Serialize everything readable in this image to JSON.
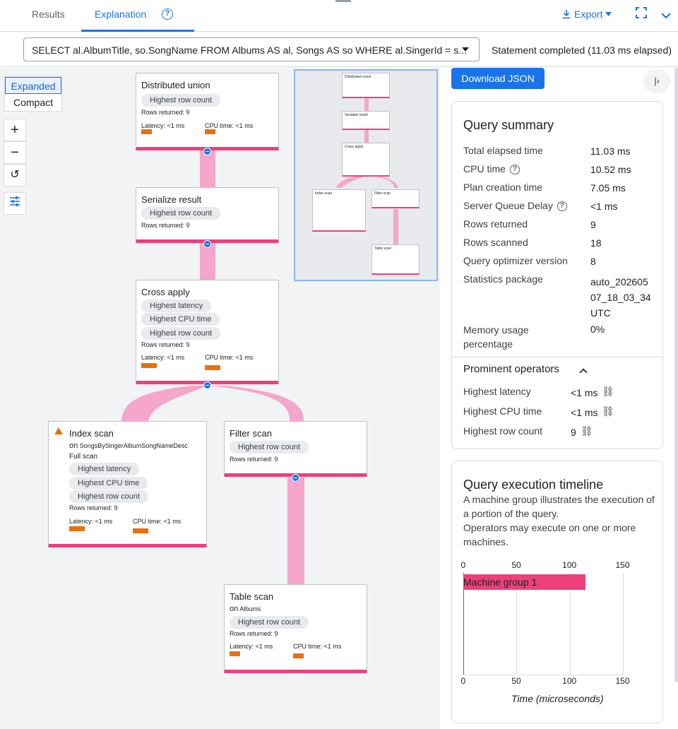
{
  "tabs": {
    "results": "Results",
    "explanation": "Explanation"
  },
  "toolbar": {
    "export_label": "Export"
  },
  "query": {
    "text": "SELECT al.AlbumTitle, so.SongName FROM Albums AS al, Songs AS so WHERE al.SingerId = s...",
    "status": "Statement completed (11.03 ms elapsed)"
  },
  "view": {
    "expanded": "Expanded",
    "compact": "Compact"
  },
  "nodes": {
    "distributed_union": {
      "title": "Distributed union",
      "chips": [
        "Highest row count"
      ],
      "rows": "Rows returned: 9",
      "latency": "Latency: <1 ms",
      "cpu": "CPU time: <1 ms"
    },
    "serialize_result": {
      "title": "Serialize result",
      "chips": [
        "Highest row count"
      ],
      "rows": "Rows returned: 9"
    },
    "cross_apply": {
      "title": "Cross apply",
      "chips": [
        "Highest latency",
        "Highest CPU time",
        "Highest row count"
      ],
      "rows": "Rows returned: 9",
      "latency": "Latency: <1 ms",
      "cpu": "CPU time: <1 ms"
    },
    "index_scan": {
      "title": "Index scan",
      "on_prefix": "on",
      "on_target": "SongsBySingerAlbumSongNameDesc",
      "scan_type": "Full scan",
      "chips": [
        "Highest latency",
        "Highest CPU time",
        "Highest row count"
      ],
      "rows": "Rows returned: 9",
      "latency": "Latency: <1 ms",
      "cpu": "CPU time: <1 ms"
    },
    "filter_scan": {
      "title": "Filter scan",
      "chips": [
        "Highest row count"
      ],
      "rows": "Rows returned: 9"
    },
    "table_scan": {
      "title": "Table scan",
      "on_prefix": "on",
      "on_target": "Albums",
      "chips": [
        "Highest row count"
      ],
      "rows": "Rows returned: 9",
      "latency": "Latency: <1 ms",
      "cpu": "CPU time: <1 ms"
    }
  },
  "panel": {
    "download_label": "Download JSON",
    "summary_title": "Query summary",
    "summary": [
      {
        "label": "Total elapsed time",
        "value": "11.03 ms"
      },
      {
        "label": "CPU time",
        "value": "10.52 ms",
        "help": true
      },
      {
        "label": "Plan creation time",
        "value": "7.05 ms"
      },
      {
        "label": "Server Queue Delay",
        "value": "<1 ms",
        "help": true
      },
      {
        "label": "Rows returned",
        "value": "9"
      },
      {
        "label": "Rows scanned",
        "value": "18"
      },
      {
        "label": "Query optimizer version",
        "value": "8"
      },
      {
        "label": "Statistics package",
        "value": "auto_20260507_18_03_34UTC"
      },
      {
        "label": "Memory usage percentage",
        "value": "0%"
      }
    ],
    "stat_pkg_lines": [
      "auto_202605",
      "07_18_03_34",
      "UTC"
    ],
    "memory_label_lines": [
      "Memory usage",
      "percentage"
    ],
    "prominent_title": "Prominent operators",
    "prominent": [
      {
        "label": "Highest latency",
        "value": "<1 ms"
      },
      {
        "label": "Highest CPU time",
        "value": "<1 ms"
      },
      {
        "label": "Highest row count",
        "value": "9"
      }
    ],
    "timeline_title": "Query execution timeline",
    "timeline_desc_1": "A machine group illustrates the execution of a portion of the query.",
    "timeline_desc_2": "Operators may execute on one or more machines.",
    "timeline_axis_title": "Time (microseconds)"
  },
  "chart_data": {
    "type": "bar",
    "orientation": "horizontal",
    "categories": [
      "Machine group 1"
    ],
    "values": [
      115
    ],
    "xlim": [
      0,
      150
    ],
    "xticks": [
      0,
      50,
      100,
      150
    ],
    "xlabel": "Time (microseconds)",
    "colors": {
      "bar": "#ec407a"
    }
  },
  "colors": {
    "accent": "#1a73e8",
    "node_border": "#ec407a",
    "metric_bar": "#e8710a",
    "edge": "#f4a6cb"
  }
}
